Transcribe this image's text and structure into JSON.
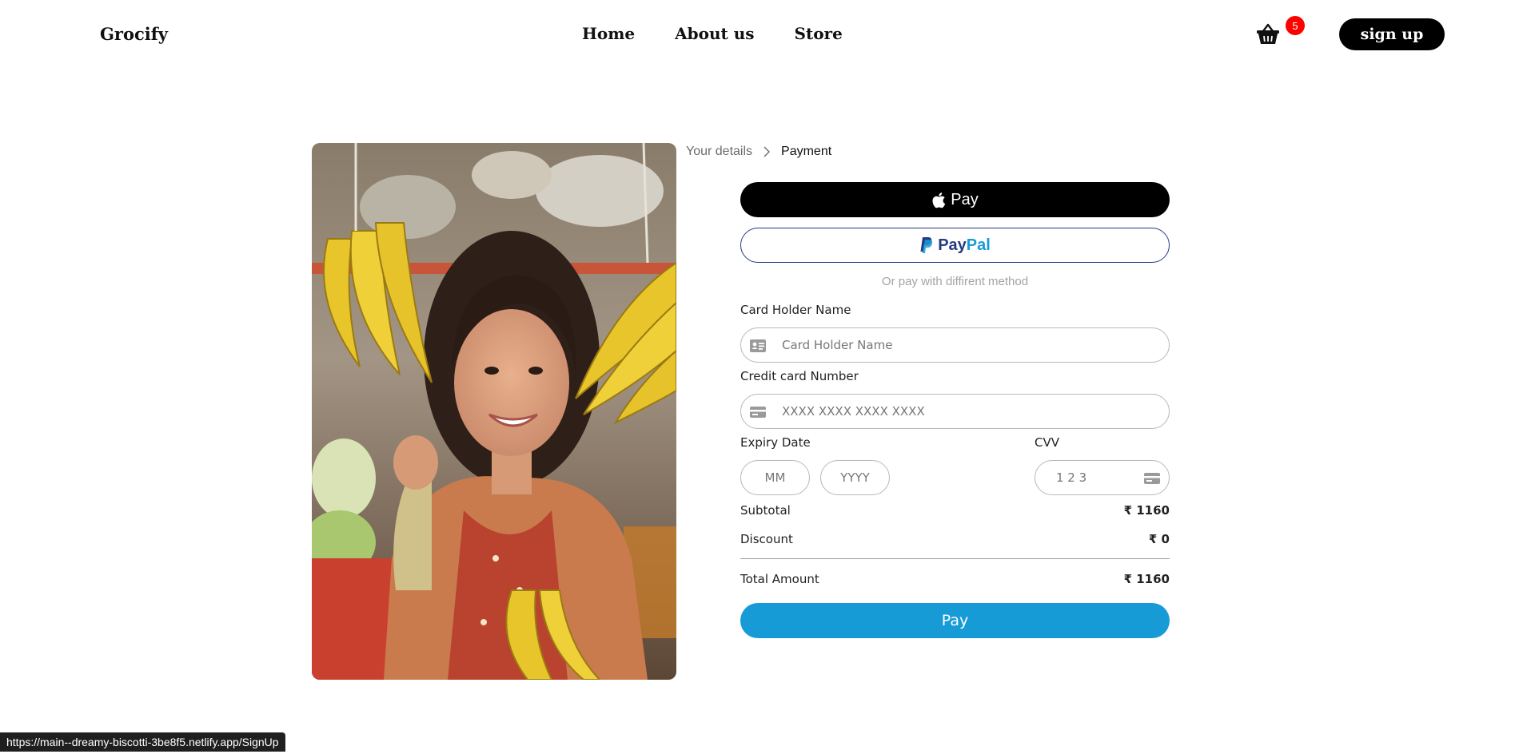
{
  "header": {
    "brand": "Grocify",
    "nav": [
      "Home",
      "About us",
      "Store"
    ],
    "cart_icon": "basket-icon",
    "cart_count": "5",
    "signup_label": "sign up"
  },
  "hero_image": {
    "icon": "photo-woman-bananas"
  },
  "breadcrumb": {
    "step1": "Your details",
    "separator_icon": "chevron-right-icon",
    "step2": "Payment"
  },
  "payment": {
    "apple_pay_label": "Pay",
    "apple_icon": "apple-icon",
    "paypal_part1": "Pay",
    "paypal_part2": "Pal",
    "paypal_icon": "paypal-icon",
    "or_text": "Or pay with diffirent method",
    "card_holder_label": "Card Holder Name",
    "card_holder_placeholder": "Card Holder Name",
    "card_number_label": "Credit card Number",
    "card_number_placeholder": "XXXX XXXX XXXX XXXX",
    "expiry_label": "Expiry Date",
    "mm_placeholder": "MM",
    "yyyy_placeholder": "YYYY",
    "cvv_label": "CVV",
    "cvv_placeholder": "1 2 3",
    "pay_label": "Pay"
  },
  "summary": {
    "subtotal_label": "Subtotal",
    "subtotal_value": "₹ 1160",
    "discount_label": "Discount",
    "discount_value": "₹ 0",
    "total_label": "Total Amount",
    "total_value": "₹ 1160"
  },
  "status_bar": {
    "url": "https://main--dreamy-biscotti-3be8f5.netlify.app/SignUp"
  },
  "colors": {
    "pay_button": "#179bd7",
    "paypal_dark": "#253b80",
    "paypal_light": "#179bd7",
    "badge": "#ff0000"
  }
}
